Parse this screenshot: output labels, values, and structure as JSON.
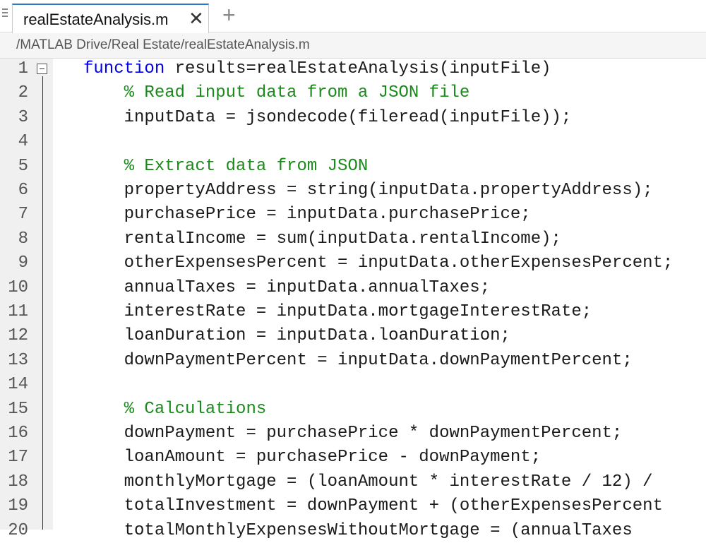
{
  "tab": {
    "title": "realEstateAnalysis.m",
    "close_glyph": "✕",
    "add_glyph": "+"
  },
  "path": "/MATLAB Drive/Real Estate/realEstateAnalysis.m",
  "colors": {
    "keyword": "#0000ee",
    "comment": "#1a8a1a",
    "accent": "#2b78c5"
  },
  "lines": [
    {
      "n": "1",
      "indent": "",
      "kw": "function",
      "text": " results=realEstateAnalysis(inputFile)",
      "comment": ""
    },
    {
      "n": "2",
      "indent": "    ",
      "kw": "",
      "text": "",
      "comment": "% Read input data from a JSON file"
    },
    {
      "n": "3",
      "indent": "    ",
      "kw": "",
      "text": "inputData = jsondecode(fileread(inputFile));",
      "comment": ""
    },
    {
      "n": "4",
      "indent": "",
      "kw": "",
      "text": "",
      "comment": ""
    },
    {
      "n": "5",
      "indent": "    ",
      "kw": "",
      "text": "",
      "comment": "% Extract data from JSON"
    },
    {
      "n": "6",
      "indent": "    ",
      "kw": "",
      "text": "propertyAddress = string(inputData.propertyAddress);",
      "comment": ""
    },
    {
      "n": "7",
      "indent": "    ",
      "kw": "",
      "text": "purchasePrice = inputData.purchasePrice;",
      "comment": ""
    },
    {
      "n": "8",
      "indent": "    ",
      "kw": "",
      "text": "rentalIncome = sum(inputData.rentalIncome);",
      "comment": ""
    },
    {
      "n": "9",
      "indent": "    ",
      "kw": "",
      "text": "otherExpensesPercent = inputData.otherExpensesPercent;",
      "comment": ""
    },
    {
      "n": "10",
      "indent": "    ",
      "kw": "",
      "text": "annualTaxes = inputData.annualTaxes;",
      "comment": ""
    },
    {
      "n": "11",
      "indent": "    ",
      "kw": "",
      "text": "interestRate = inputData.mortgageInterestRate;",
      "comment": ""
    },
    {
      "n": "12",
      "indent": "    ",
      "kw": "",
      "text": "loanDuration = inputData.loanDuration;",
      "comment": ""
    },
    {
      "n": "13",
      "indent": "    ",
      "kw": "",
      "text": "downPaymentPercent = inputData.downPaymentPercent;",
      "comment": ""
    },
    {
      "n": "14",
      "indent": "",
      "kw": "",
      "text": "",
      "comment": ""
    },
    {
      "n": "15",
      "indent": "    ",
      "kw": "",
      "text": "",
      "comment": "% Calculations"
    },
    {
      "n": "16",
      "indent": "    ",
      "kw": "",
      "text": "downPayment = purchasePrice * downPaymentPercent;",
      "comment": ""
    },
    {
      "n": "17",
      "indent": "    ",
      "kw": "",
      "text": "loanAmount = purchasePrice - downPayment;",
      "comment": ""
    },
    {
      "n": "18",
      "indent": "    ",
      "kw": "",
      "text": "monthlyMortgage = (loanAmount * interestRate / 12) /",
      "comment": ""
    },
    {
      "n": "19",
      "indent": "    ",
      "kw": "",
      "text": "totalInvestment = downPayment + (otherExpensesPercent",
      "comment": ""
    },
    {
      "n": "20",
      "indent": "    ",
      "kw": "",
      "text": "totalMonthlyExpensesWithoutMortgage = (annualTaxes",
      "comment": ""
    }
  ]
}
